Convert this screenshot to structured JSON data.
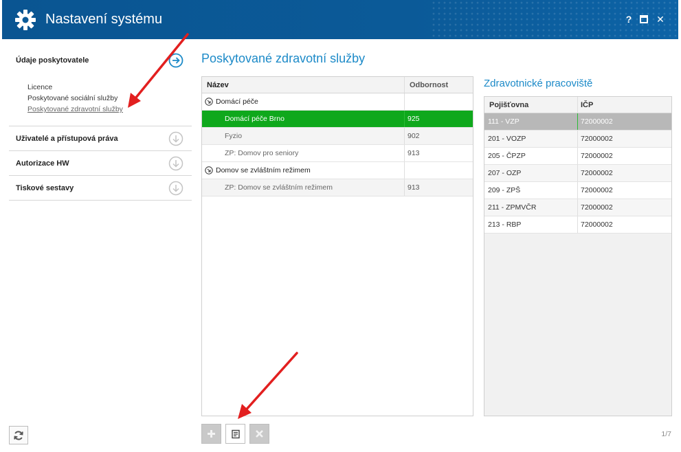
{
  "window": {
    "title": "Nastavení systému",
    "help_label": "?",
    "close_label": "✕"
  },
  "sidebar": {
    "sections": [
      {
        "label": "Údaje poskytovatele",
        "expanded": true,
        "items": [
          {
            "label": "Licence"
          },
          {
            "label": "Poskytované sociální služby"
          },
          {
            "label": "Poskytované zdravotní služby",
            "active": true
          }
        ]
      },
      {
        "label": "Uživatelé a přístupová práva",
        "expanded": false
      },
      {
        "label": "Autorizace HW",
        "expanded": false
      },
      {
        "label": "Tiskové sestavy",
        "expanded": false
      }
    ]
  },
  "main": {
    "title": "Poskytované zdravotní služby",
    "services_table": {
      "columns": [
        "Název",
        "Odbornost"
      ],
      "rows": [
        {
          "type": "group",
          "name": "Domácí péče",
          "odbornost": ""
        },
        {
          "type": "child",
          "name": "Domácí péče Brno",
          "odbornost": "925",
          "selected": true
        },
        {
          "type": "child",
          "name": "Fyzio",
          "odbornost": "902"
        },
        {
          "type": "child",
          "name": "ZP: Domov pro seniory",
          "odbornost": "913"
        },
        {
          "type": "group",
          "name": "Domov se zvláštním režimem",
          "odbornost": ""
        },
        {
          "type": "child",
          "name": "ZP: Domov se zvláštním režimem",
          "odbornost": "913"
        }
      ]
    }
  },
  "workplaces": {
    "title": "Zdravotnické pracoviště",
    "columns": [
      "Pojišťovna",
      "IČP"
    ],
    "rows": [
      {
        "pojistovna": "111 - VZP",
        "icp": "72000002",
        "selected": true
      },
      {
        "pojistovna": "201 - VOZP",
        "icp": "72000002"
      },
      {
        "pojistovna": "205 - ČPZP",
        "icp": "72000002"
      },
      {
        "pojistovna": "207 - OZP",
        "icp": "72000002"
      },
      {
        "pojistovna": "209 - ZPŠ",
        "icp": "72000002"
      },
      {
        "pojistovna": "211 - ZPMVČR",
        "icp": "72000002"
      },
      {
        "pojistovna": "213 - RBP",
        "icp": "72000002"
      }
    ]
  },
  "toolbar": {
    "add_icon": "plus-icon",
    "edit_icon": "edit-icon",
    "delete_icon": "delete-icon",
    "page_indicator": "1/7"
  },
  "colors": {
    "titlebar": "#0b5a98",
    "accent": "#1c8ac8",
    "selected_row": "#0fa81c",
    "selected_row_gray": "#b8b8b8",
    "annotation_arrow": "#e21f1f"
  }
}
